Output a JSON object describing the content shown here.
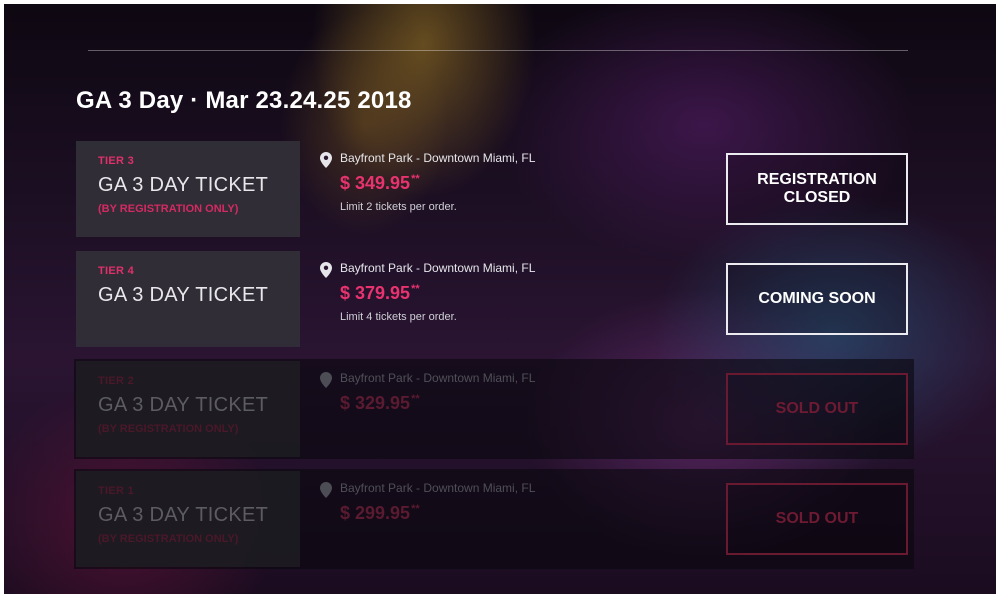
{
  "event": {
    "title": "GA 3 Day · Mar 23.24.25 2018"
  },
  "tickets": [
    {
      "tier": "TIER 3",
      "name": "GA 3 DAY TICKET",
      "note": "(BY REGISTRATION ONLY)",
      "venue": "Bayfront Park - Downtown Miami, FL",
      "price": "$ 349.95",
      "price_marker": "**",
      "limit": "Limit 2 tickets per order.",
      "action_line1": "REGISTRATION",
      "action_line2": "CLOSED",
      "status": "available"
    },
    {
      "tier": "TIER 4",
      "name": "GA 3 DAY TICKET",
      "note": "",
      "venue": "Bayfront Park - Downtown Miami, FL",
      "price": "$ 379.95",
      "price_marker": "**",
      "limit": "Limit 4 tickets per order.",
      "action_line1": "COMING SOON",
      "action_line2": "",
      "status": "available"
    },
    {
      "tier": "TIER 2",
      "name": "GA 3 DAY TICKET",
      "note": "(BY REGISTRATION ONLY)",
      "venue": "Bayfront Park - Downtown Miami, FL",
      "price": "$ 329.95",
      "price_marker": "**",
      "limit": "",
      "action_line1": "SOLD OUT",
      "action_line2": "",
      "status": "sold-out"
    },
    {
      "tier": "TIER 1",
      "name": "GA 3 DAY TICKET",
      "note": "(BY REGISTRATION ONLY)",
      "venue": "Bayfront Park - Downtown Miami, FL",
      "price": "$ 299.95",
      "price_marker": "**",
      "limit": "",
      "action_line1": "SOLD OUT",
      "action_line2": "",
      "status": "sold-out"
    }
  ],
  "icons": {
    "location": "map-pin-icon"
  },
  "colors": {
    "accent": "#e8336f",
    "text": "#ffffff",
    "panel": "#323038"
  }
}
